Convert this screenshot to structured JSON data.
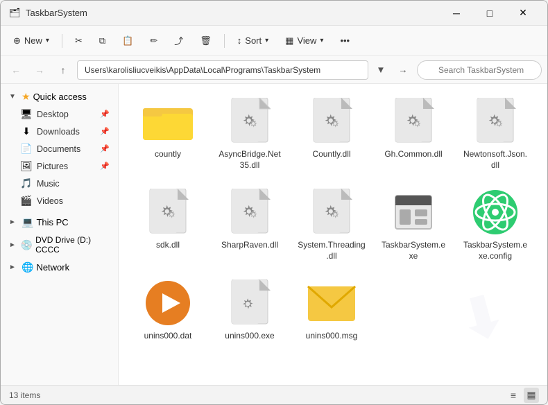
{
  "window": {
    "title": "TaskbarSystem",
    "icon": "📁"
  },
  "titlebar": {
    "minimize_label": "─",
    "maximize_label": "□",
    "close_label": "✕"
  },
  "toolbar": {
    "new_label": "New",
    "sort_label": "Sort",
    "view_label": "View",
    "more_label": "•••",
    "cut_icon": "✂",
    "copy_icon": "⧉",
    "paste_icon": "📋",
    "rename_icon": "✏",
    "delete_icon": "🗑",
    "share_icon": "⤴"
  },
  "addressbar": {
    "path": "Users\\karolisliucveikis\\AppData\\Local\\Programs\\TaskbarSystem",
    "search_placeholder": "Search TaskbarSystem"
  },
  "sidebar": {
    "quick_access_label": "Quick access",
    "items": [
      {
        "label": "Desktop",
        "icon": "🖥",
        "pinned": true
      },
      {
        "label": "Downloads",
        "icon": "⬇",
        "pinned": true
      },
      {
        "label": "Documents",
        "icon": "📄",
        "pinned": true
      },
      {
        "label": "Pictures",
        "icon": "🖼",
        "pinned": true
      },
      {
        "label": "Music",
        "icon": "🎵",
        "pinned": false
      },
      {
        "label": "Videos",
        "icon": "🎬",
        "pinned": false
      }
    ],
    "this_pc_label": "This PC",
    "dvd_label": "DVD Drive (D:) CCCC",
    "network_label": "Network"
  },
  "files": [
    {
      "name": "countly",
      "type": "folder"
    },
    {
      "name": "AsyncBridge.Net 35.dll",
      "type": "dll"
    },
    {
      "name": "Countly.dll",
      "type": "dll"
    },
    {
      "name": "Gh.Common.dll",
      "type": "dll"
    },
    {
      "name": "Newtonsoft.Json.dll",
      "type": "dll"
    },
    {
      "name": "sdk.dll",
      "type": "dll"
    },
    {
      "name": "SharpRaven.dll",
      "type": "dll"
    },
    {
      "name": "System.Threading.dll",
      "type": "dll"
    },
    {
      "name": "TaskbarSystem.exe",
      "type": "exe"
    },
    {
      "name": "TaskbarSystem.exe.config",
      "type": "config"
    },
    {
      "name": "unins000.dat",
      "type": "dat"
    },
    {
      "name": "unins000.exe",
      "type": "uninstall_exe"
    },
    {
      "name": "unins000.msg",
      "type": "msg"
    }
  ],
  "statusbar": {
    "count_label": "13 items"
  }
}
